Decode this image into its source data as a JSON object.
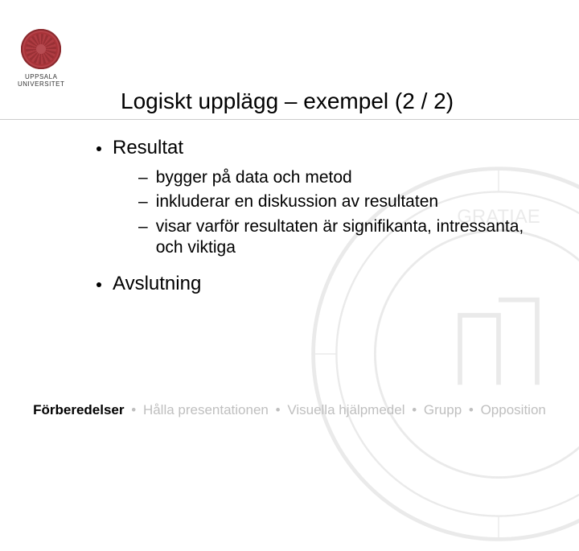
{
  "logo": {
    "line1": "UPPSALA",
    "line2": "UNIVERSITET"
  },
  "title": "Logiskt upplägg – exempel (2 / 2)",
  "section1": {
    "heading": "Resultat",
    "items": [
      "bygger på data och metod",
      "inkluderar en diskussion av resultaten",
      "visar varför resultaten är signifikanta, intressanta, och viktiga"
    ]
  },
  "section2": {
    "heading": "Avslutning"
  },
  "footer": {
    "items": [
      {
        "label": "Förberedelser",
        "active": true
      },
      {
        "label": "Hålla presentationen",
        "active": false
      },
      {
        "label": "Visuella hjälpmedel",
        "active": false
      },
      {
        "label": "Grupp",
        "active": false
      },
      {
        "label": "Opposition",
        "active": false
      }
    ],
    "sep": "•"
  }
}
